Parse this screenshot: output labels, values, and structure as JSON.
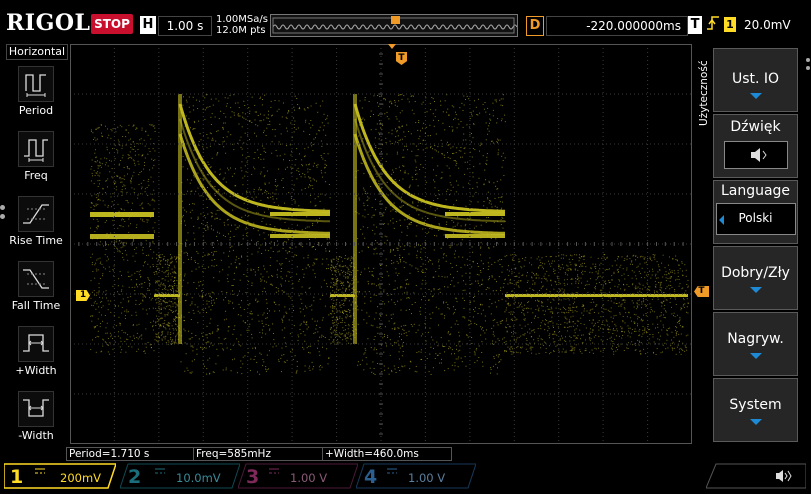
{
  "top": {
    "brand": "RIGOL",
    "status": "STOP",
    "horizontal_key": "H",
    "timebase": "1.00 s",
    "sample_rate": "1.00MSa/s",
    "memory_depth": "12.0M pts",
    "delay_key": "D",
    "delay": "-220.000000ms",
    "trigger_key": "T",
    "trigger_edge": "rising",
    "trigger_channel": "1",
    "trigger_level": "20.0mV"
  },
  "left_menu": {
    "title": "Horizontal",
    "items": [
      {
        "label": "Period",
        "icon": "period-icon"
      },
      {
        "label": "Freq",
        "icon": "frequency-icon"
      },
      {
        "label": "Rise Time",
        "icon": "rise-time-icon"
      },
      {
        "label": "Fall Time",
        "icon": "fall-time-icon"
      },
      {
        "label": "+Width",
        "icon": "positive-width-icon"
      },
      {
        "label": "-Width",
        "icon": "negative-width-icon"
      }
    ]
  },
  "right_menu": {
    "title": "Użyteczność",
    "buttons": [
      {
        "label": "Ust. IO",
        "sub": "",
        "arrow": true
      },
      {
        "label": "Dźwięk",
        "sub": "🔈",
        "arrow": false
      },
      {
        "label": "Language",
        "sub": "Polski",
        "arrow": false
      },
      {
        "label": "Dobry/Zły",
        "sub": "",
        "arrow": true
      },
      {
        "label": "Nagryw.",
        "sub": "",
        "arrow": true
      },
      {
        "label": "System",
        "sub": "",
        "arrow": true
      }
    ]
  },
  "measurements": {
    "period": "Period=1.710 s",
    "freq": "Freq=585mHz",
    "width": "+Width=460.0ms"
  },
  "channels": [
    {
      "num": "1",
      "coupling": "DC",
      "scale": "200mV",
      "color": "#ffdb26",
      "active": true
    },
    {
      "num": "2",
      "coupling": "DC",
      "scale": "10.0mV",
      "color": "#22c8e0",
      "active": false
    },
    {
      "num": "3",
      "coupling": "DC",
      "scale": "1.00 V",
      "color": "#d23c8c",
      "active": false
    },
    {
      "num": "4",
      "coupling": "DC",
      "scale": "1.00 V",
      "color": "#1a7fd6",
      "active": false
    }
  ],
  "markers": {
    "ch1_marker": "1",
    "trigger_marker": "T"
  },
  "colors": {
    "trace": "#c8c020",
    "brand_red": "#c8102e",
    "delay_orange": "#f09a28"
  }
}
